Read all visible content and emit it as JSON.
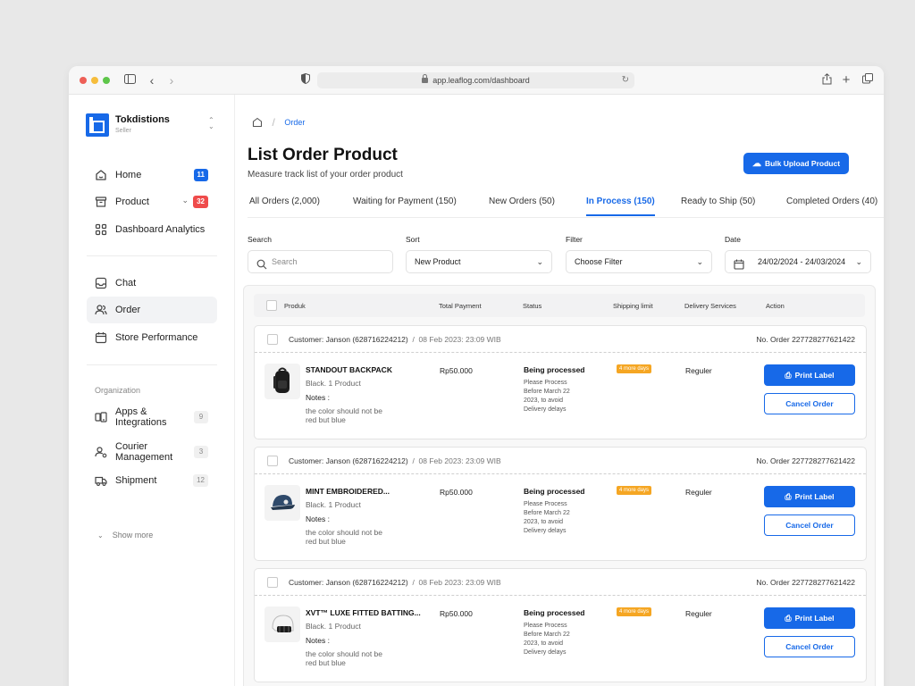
{
  "browser": {
    "url": "app.leaflog.com/dashboard"
  },
  "sidebar": {
    "brand_name": "Tokdistions",
    "brand_role": "Seller",
    "main_items": [
      {
        "label": "Home",
        "badge": "11"
      },
      {
        "label": "Product",
        "badge": "32"
      },
      {
        "label": "Dashboard Analytics"
      }
    ],
    "secondary_items": [
      {
        "label": "Chat"
      },
      {
        "label": "Order"
      },
      {
        "label": "Store Performance"
      }
    ],
    "section_title": "Organization",
    "org_items": [
      {
        "label": "Apps & Integrations",
        "badge": "9"
      },
      {
        "label": "Courier Management",
        "badge": "3"
      },
      {
        "label": "Shipment",
        "badge": "12"
      }
    ],
    "show_more": "Show more"
  },
  "breadcrumb": {
    "current": "Order"
  },
  "page": {
    "title": "List Order Product",
    "subtitle": "Measure track list of your order product",
    "bulk_upload_label": "Bulk Upload Product"
  },
  "tabs": [
    {
      "label": "All Orders (2,000)"
    },
    {
      "label": "Waiting for Payment (150)"
    },
    {
      "label": "New Orders (50)"
    },
    {
      "label": "In Process (150)",
      "active": true
    },
    {
      "label": "Ready to Ship (50)"
    },
    {
      "label": "Completed Orders (40)"
    }
  ],
  "filters": {
    "search_label": "Search",
    "search_placeholder": "Search",
    "sort_label": "Sort",
    "sort_value": "New Product",
    "filter_label": "Filter",
    "filter_value": "Choose Filter",
    "date_label": "Date",
    "date_value": "24/02/2024 - 24/03/2024"
  },
  "table": {
    "headers": [
      "Produk",
      "Total Payment",
      "Status",
      "Shipping limit",
      "Delivery Services",
      "Action"
    ]
  },
  "orders": [
    {
      "customer": "Customer: Janson (628716224212)",
      "date": "08 Feb 2023: 23:09 WIB",
      "order_no": "No. Order 227728277621422",
      "product_name": "STANDOUT BACKPACK",
      "variant": "Black. 1 Product",
      "notes_label": "Notes :",
      "notes": "the color should not be red but blue",
      "price": "Rp50.000",
      "status": "Being processed",
      "status_note": "Please Process Before March 22 2023, to avoid Delivery delays",
      "shipping_limit": "4 more days",
      "delivery": "Reguler",
      "print_label": "Print Label",
      "cancel_label": "Cancel Order",
      "icon": "backpack-icon"
    },
    {
      "customer": "Customer: Janson (628716224212)",
      "date": "08 Feb 2023: 23:09 WIB",
      "order_no": "No. Order 227728277621422",
      "product_name": "MINT EMBROIDERED...",
      "variant": "Black. 1 Product",
      "notes_label": "Notes :",
      "notes": "the color should not be red but blue",
      "price": "Rp50.000",
      "status": "Being processed",
      "status_note": "Please Process Before March 22 2023, to avoid Delivery delays",
      "shipping_limit": "4 more days",
      "delivery": "Reguler",
      "print_label": "Print Label",
      "cancel_label": "Cancel Order",
      "icon": "cap-icon"
    },
    {
      "customer": "Customer: Janson (628716224212)",
      "date": "08 Feb 2023: 23:09 WIB",
      "order_no": "No. Order 227728277621422",
      "product_name": "XVT™ LUXE FITTED BATTING...",
      "variant": "Black. 1 Product",
      "notes_label": "Notes :",
      "notes": "the color should not be red but blue",
      "price": "Rp50.000",
      "status": "Being processed",
      "status_note": "Please Process Before March 22 2023, to avoid Delivery delays",
      "shipping_limit": "4 more days",
      "delivery": "Reguler",
      "print_label": "Print Label",
      "cancel_label": "Cancel Order",
      "icon": "helmet-icon"
    }
  ],
  "colors": {
    "accent": "#1769e8",
    "danger": "#ef4b4b",
    "warning": "#f5a623"
  }
}
